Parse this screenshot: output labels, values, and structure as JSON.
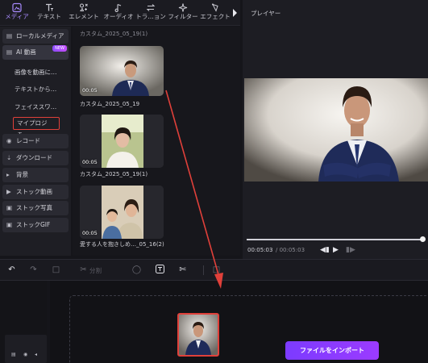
{
  "tabs": [
    {
      "label": "メディア",
      "icon": "media-icon",
      "active": true
    },
    {
      "label": "テキスト",
      "icon": "text-icon"
    },
    {
      "label": "エレメント",
      "icon": "element-icon"
    },
    {
      "label": "オーディオ",
      "icon": "audio-icon"
    },
    {
      "label": "トラ…ョン",
      "icon": "transition-icon"
    },
    {
      "label": "フィルター",
      "icon": "filter-icon"
    },
    {
      "label": "エフェクト",
      "icon": "effect-icon"
    }
  ],
  "sidebar": {
    "local_media": "ローカルメディア",
    "ai_video": "AI 動画",
    "new_badge": "NEW",
    "sub_items": [
      "画像を動画に…",
      "テキストから…",
      "フェイススワ…"
    ],
    "my_project": "マイプロジェ…",
    "record": "レコード",
    "download": "ダウンロード",
    "background": "背景",
    "stock_video": "ストック動画",
    "stock_photo": "ストック写真",
    "stock_gif": "ストックGIF"
  },
  "media": {
    "top_caption": "カスタム_2025_05_19(1)",
    "items": [
      {
        "caption": "カスタム_2025_05_19",
        "duration": "00:05"
      },
      {
        "caption": "カスタム_2025_05_19(1)",
        "duration": "00:05"
      },
      {
        "caption": "愛する人を抱きしめ…_05_16(2)",
        "duration": "00:05"
      }
    ]
  },
  "player": {
    "title": "プレイヤー",
    "current_time": "00:05:03",
    "total_time": "/ 00:05:03"
  },
  "toolbar": {
    "split_label": "分割"
  },
  "timeline": {
    "import_button": "ファイルをインポート"
  },
  "colors": {
    "accent": "#9b3bff",
    "highlight_red": "#e0403a",
    "active_tab": "#a98bff"
  }
}
